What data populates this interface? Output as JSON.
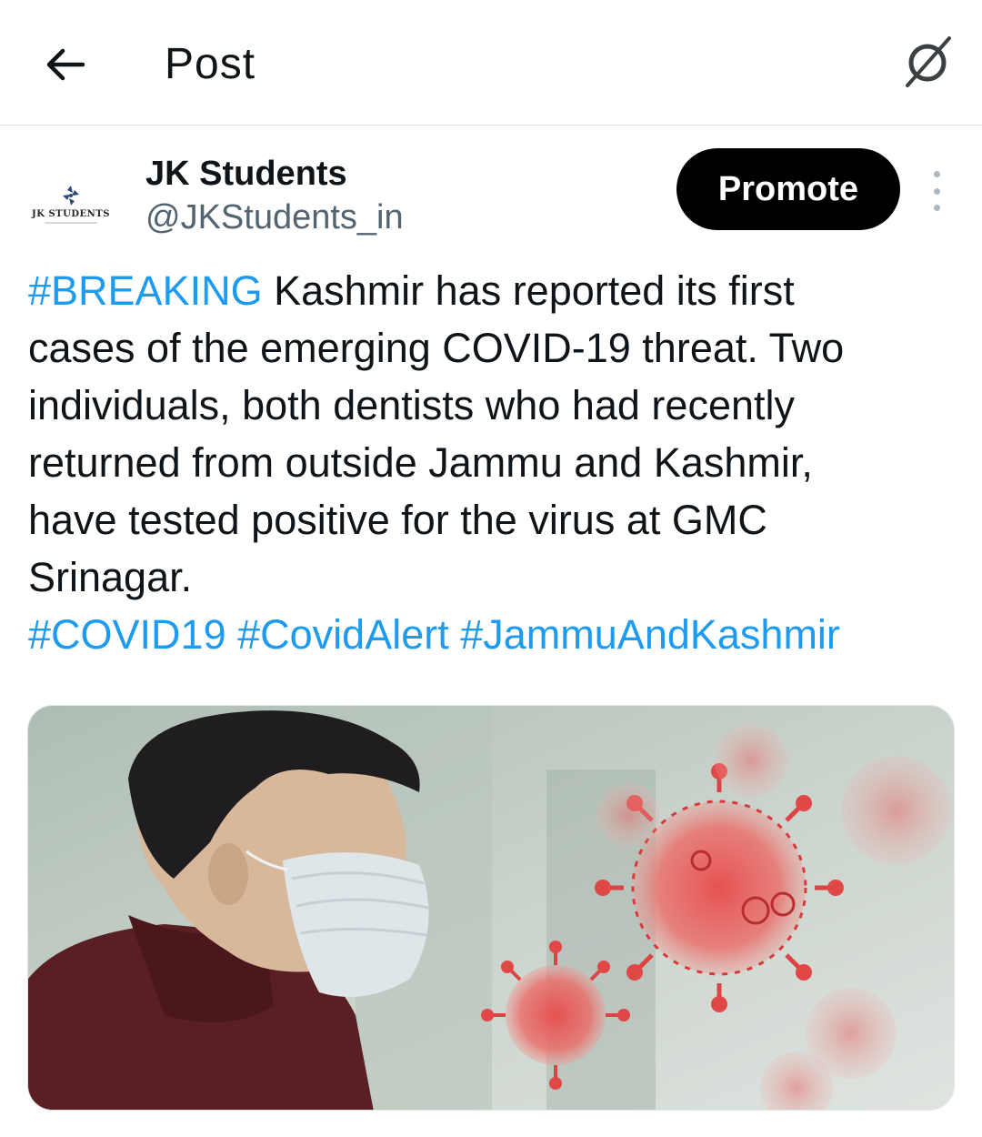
{
  "header": {
    "title": "Post",
    "back_icon": "arrow-left-icon",
    "right_icon": "slashed-circle-icon"
  },
  "author": {
    "display_name": "JK Students",
    "handle": "@JKStudents_in",
    "avatar_text": "JK STUDENTS",
    "promote_label": "Promote",
    "more_icon": "more-vertical-icon"
  },
  "post": {
    "line1_tag": "#BREAKING",
    "line1_text": " Kashmir has reported its first",
    "line2": "cases of the emerging COVID-19 threat. Two",
    "line3": "individuals, both dentists who had recently",
    "line4": "returned from outside Jammu and Kashmir,",
    "line5": "have tested positive for the virus at GMC",
    "line6": "Srinagar.",
    "hashtags": [
      "#COVID19",
      "#CovidAlert",
      "#JammuAndKashmir"
    ]
  },
  "colors": {
    "link": "#1d9bf0",
    "promote_bg": "#000000",
    "handle": "#536471"
  }
}
